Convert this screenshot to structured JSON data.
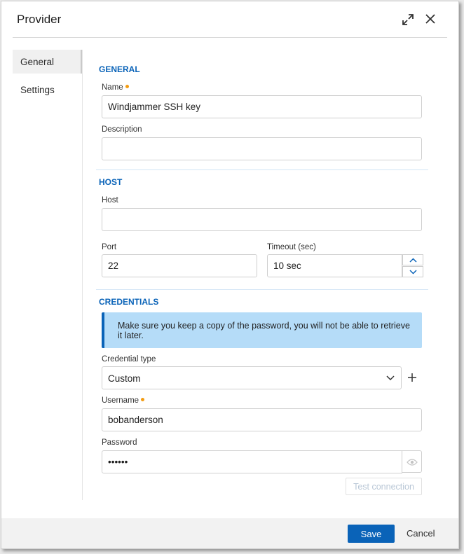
{
  "dialog": {
    "title": "Provider"
  },
  "nav": {
    "items": [
      {
        "label": "General",
        "active": true
      },
      {
        "label": "Settings",
        "active": false
      }
    ]
  },
  "general": {
    "section_title": "GENERAL",
    "name_label": "Name",
    "name_value": "Windjammer SSH key",
    "description_label": "Description",
    "description_value": ""
  },
  "host": {
    "section_title": "HOST",
    "host_label": "Host",
    "host_value": "",
    "port_label": "Port",
    "port_value": "22",
    "timeout_label": "Timeout (sec)",
    "timeout_value": "10 sec"
  },
  "credentials": {
    "section_title": "CREDENTIALS",
    "info_message": "Make sure you keep a copy of the password, you will not be able to retrieve it later.",
    "credential_type_label": "Credential type",
    "credential_type_value": "Custom",
    "username_label": "Username",
    "username_value": "bobanderson",
    "password_label": "Password",
    "password_value": "••••••",
    "test_connection_label": "Test connection"
  },
  "footer": {
    "save_label": "Save",
    "cancel_label": "Cancel"
  },
  "colors": {
    "accent": "#0a63b8",
    "required_dot": "#f39c12",
    "info_background": "#b5dcf8"
  }
}
